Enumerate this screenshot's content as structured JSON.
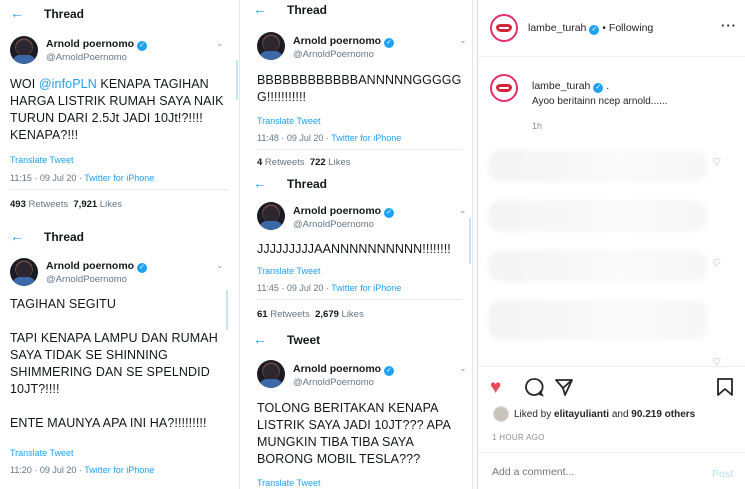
{
  "colors": {
    "twitter_blue": "#1da1f2",
    "ig_like_red": "#ed4956"
  },
  "col1": {
    "t1": {
      "header_title": "Thread",
      "user_name": "Arnold poernomo",
      "user_handle": "@ArnoldPoernomo",
      "text_mention": "@infoPLN",
      "text_pre": "WOI ",
      "text_post": " KENAPA TAGIHAN HARGA LISTRIK RUMAH SAYA NAIK TURUN DARI 2.5Jt JADI 10Jt!?!!!! KENAPA?!!!",
      "translate": "Translate Tweet",
      "time": "11:15 · 09 Jul 20 · ",
      "source": "Twitter for iPhone",
      "retweets": "493",
      "retweets_label": " Retweets",
      "likes": "7,921",
      "likes_label": " Likes"
    },
    "t2": {
      "header_title": "Thread",
      "user_name": "Arnold poernomo",
      "user_handle": "@ArnoldPoernomo",
      "line1": "TAGIHAN SEGITU",
      "line2": "TAPI KENAPA LAMPU DAN RUMAH SAYA TIDAK SE SHINNING SHIMMERING DAN SE SPELNDID 10JT?!!!!",
      "line3": "ENTE MAUNYA APA INI HA?!!!!!!!!!",
      "translate": "Translate Tweet",
      "time": "11:20 · 09 Jul 20 · ",
      "source": "Twitter for iPhone"
    }
  },
  "col2": {
    "t1": {
      "header_title": "Thread",
      "user_name": "Arnold poernomo",
      "user_handle": "@ArnoldPoernomo",
      "text": "BBBBBBBBBBBBANNNNNGGGGGG!!!!!!!!!!!",
      "translate": "Translate Tweet",
      "time": "11:48 · 09 Jul 20 · ",
      "source": "Twitter for iPhone",
      "retweets": "4",
      "retweets_label": " Retweets",
      "likes": "722",
      "likes_label": " Likes"
    },
    "t2": {
      "header_title": "Thread",
      "user_name": "Arnold poernomo",
      "user_handle": "@ArnoldPoernomo",
      "text": "JJJJJJJJJAANNNNNNNNNN!!!!!!!!",
      "translate": "Translate Tweet",
      "time": "11:45 · 09 Jul 20 · ",
      "source": "Twitter for iPhone",
      "retweets": "61",
      "retweets_label": " Retweets",
      "likes": "2,679",
      "likes_label": " Likes"
    },
    "t3": {
      "header_title": "Tweet",
      "user_name": "Arnold poernomo",
      "user_handle": "@ArnoldPoernomo",
      "text": "TOLONG BERITAKAN KENAPA LISTRIK SAYA JADI 10JT??? APA MUNGKIN TIBA TIBA SAYA BORONG MOBIL TESLA???",
      "translate": "Translate Tweet"
    }
  },
  "instagram": {
    "account": "lambe_turah",
    "follow_status": "Following",
    "caption_user": "lambe_turah",
    "caption_text": "Ayoo beritainn ncep arnold......",
    "caption_time": "1h",
    "liked_prefix": "Liked by ",
    "liked_user": "elitayulianti",
    "liked_mid": " and ",
    "liked_count": "90.219 others",
    "post_age": "1 HOUR AGO",
    "comment_placeholder": "Add a comment...",
    "post_label": "Post"
  }
}
